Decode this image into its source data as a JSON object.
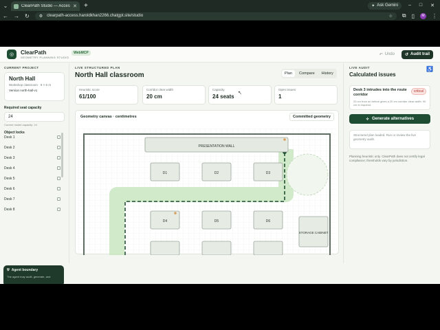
{
  "browser": {
    "tab_title": "ClearPath Studio — Accessible",
    "new_tab": "+",
    "ask_gemini": "Ask Gemini",
    "url": "clearpath-access.haroldkhan2266.chatgpt.site/studio",
    "profile_initial": "M"
  },
  "header": {
    "logo_glyph": "◎",
    "brand_name": "ClearPath",
    "brand_sub": "GEOMETRY PLANNING STUDIO",
    "badge": "WebMCP",
    "undo_label": "Undo",
    "audit_label": "Audit trail"
  },
  "left": {
    "project_section": "CURRENT PROJECT",
    "project_title": "North Hall",
    "project_sub": "Workshop classroom · 9 × 6 m",
    "project_version": "Version north-hall-v1",
    "req_label": "Required seat capacity",
    "req_value": "24",
    "req_hint": "Current model capacity: 24",
    "locks_label": "Object locks",
    "locks": [
      "Desk 1",
      "Desk 2",
      "Desk 3",
      "Desk 4",
      "Desk 5",
      "Desk 6",
      "Desk 7",
      "Desk 8"
    ],
    "boundary_title": "Agent boundary",
    "boundary_body": "The agent may audit, generate, and"
  },
  "center": {
    "live_label": "LIVE STRUCTURED PLAN",
    "room_title": "North Hall classroom",
    "tabs": [
      {
        "label": "Plan",
        "active": true
      },
      {
        "label": "Compare",
        "active": false
      },
      {
        "label": "History",
        "active": false
      }
    ],
    "metrics": [
      {
        "label": "Heuristic score",
        "value": "61/100"
      },
      {
        "label": "Corridor clear width",
        "value": "20 cm"
      },
      {
        "label": "Capacity",
        "value": "24 seats"
      },
      {
        "label": "Open issues",
        "value": "1"
      }
    ],
    "canvas_title": "Geometry canvas · centimetres",
    "canvas_badge": "Committed geometry",
    "plan": {
      "wall_label": "PRESENTATION WALL",
      "desks": [
        "D1",
        "D2",
        "D3",
        "D4",
        "D5",
        "D6"
      ],
      "cabinet_label": "STORAGE CABINET"
    }
  },
  "right": {
    "section": "LIVE AUDIT",
    "title": "Calculated issues",
    "issue_title": "Desk 3 intrudes into the route corridor",
    "issue_badge": "critical",
    "issue_detail": "20 cm from an before gives a 20 cm corridor clear width. 90 cm is required.",
    "generate_label": "Generate alternatives",
    "status": "Structured plan loaded. Run or review the live geometry audit.",
    "disclaimer": "Planning heuristic only. ClearPath does not certify legal compliance; thresholds vary by jurisdiction."
  },
  "colors": {
    "brand_dark": "#1f4d33",
    "route_green": "#bfe0b8",
    "critical": "#b0362f"
  }
}
